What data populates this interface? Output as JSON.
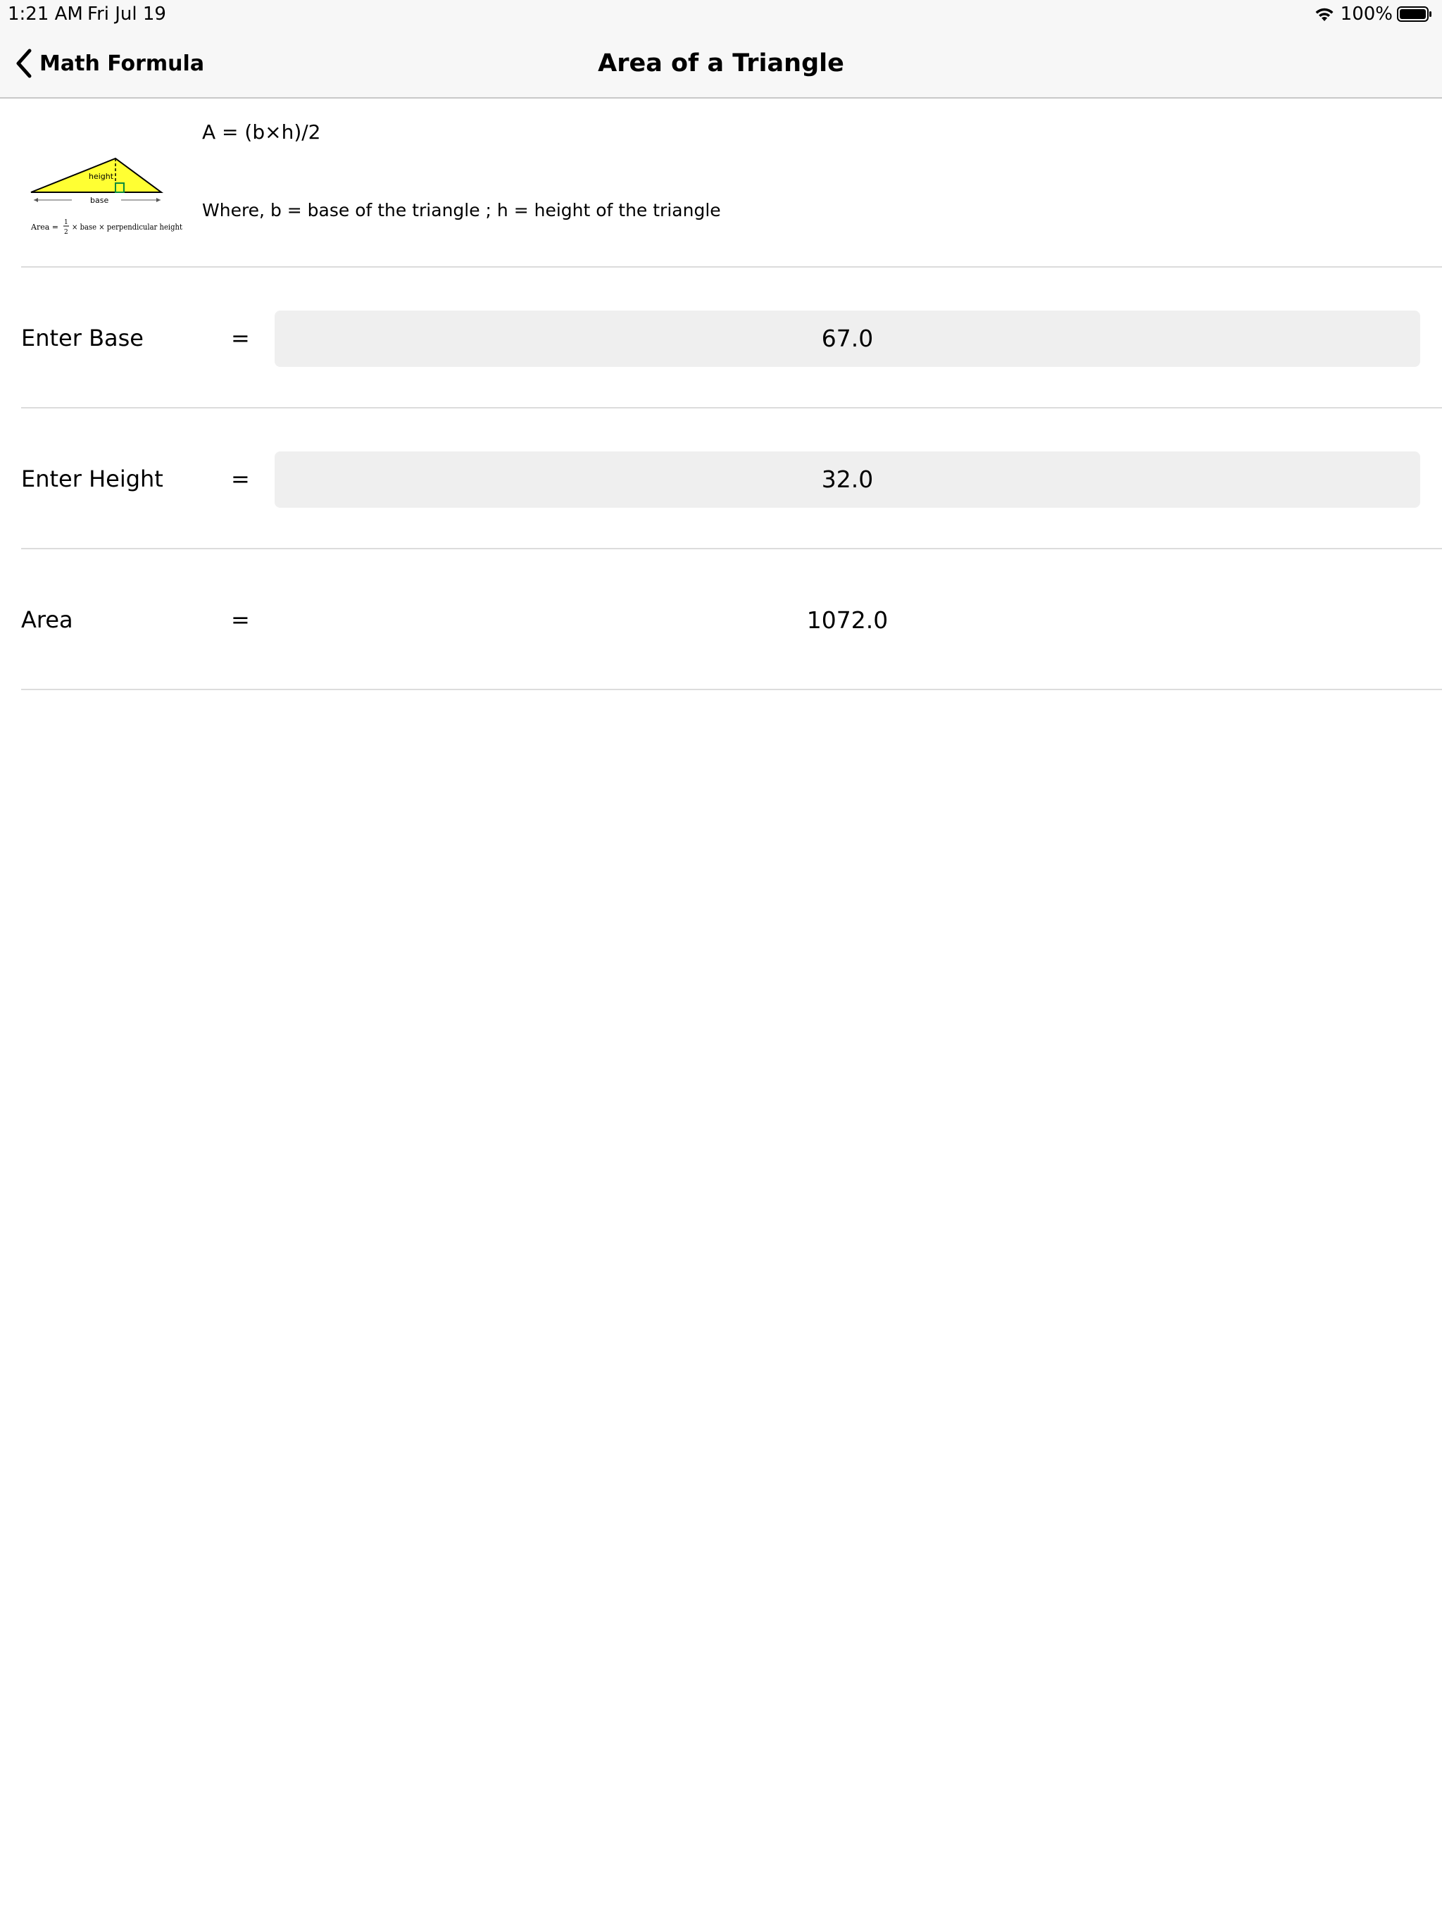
{
  "status_bar": {
    "time": "1:21 AM",
    "date": "Fri Jul 19",
    "battery": "100%",
    "wifi_icon": "wifi-icon",
    "battery_icon": "battery-icon"
  },
  "nav": {
    "back_label": "Math Formula",
    "back_icon": "chevron-left-icon",
    "title": "Area of a Triangle"
  },
  "formula": {
    "main": "A = (b×h)/2",
    "where": "Where, b = base of the triangle ; h = height of the triangle",
    "figure": {
      "height_label": "height",
      "base_label": "base",
      "caption_prefix": "Area =",
      "caption_fraction_num": "1",
      "caption_fraction_den": "2",
      "caption_suffix": "× base × perpendicular height",
      "fill_color": "#ffff33"
    }
  },
  "rows": {
    "base": {
      "label": "Enter Base",
      "equals": "=",
      "value": "67.0"
    },
    "height": {
      "label": "Enter Height",
      "equals": "=",
      "value": "32.0"
    },
    "area": {
      "label": "Area",
      "equals": "=",
      "value": "1072.0"
    }
  }
}
